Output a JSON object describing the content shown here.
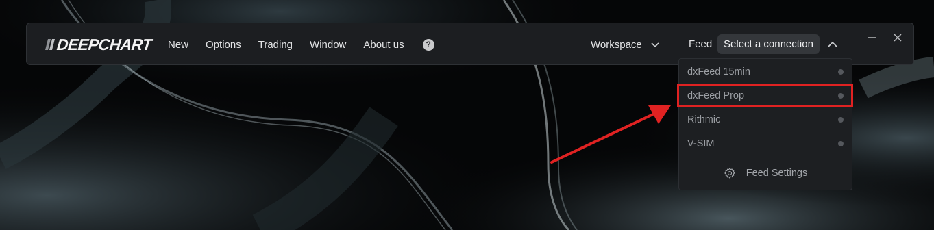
{
  "app": {
    "logo_text": "DEEPCHART"
  },
  "menu": {
    "items": [
      {
        "label": "New"
      },
      {
        "label": "Options"
      },
      {
        "label": "Trading"
      },
      {
        "label": "Window"
      },
      {
        "label": "About us"
      }
    ],
    "help_icon": "?"
  },
  "workspace": {
    "label": "Workspace"
  },
  "feed": {
    "label": "Feed",
    "connection_button": "Select a connection"
  },
  "dropdown": {
    "items": [
      {
        "label": "dxFeed 15min",
        "status": "inactive"
      },
      {
        "label": "dxFeed Prop",
        "status": "inactive",
        "highlighted": true
      },
      {
        "label": "Rithmic",
        "status": "inactive"
      },
      {
        "label": "V-SIM",
        "status": "inactive"
      }
    ],
    "settings_label": "Feed Settings"
  },
  "colors": {
    "titlebar_bg": "#1c1e21",
    "dropdown_bg": "#1d1f22",
    "annotation_red": "#e02222",
    "status_dot": "#55585d"
  },
  "icons": {
    "help": "question-circle-icon",
    "workspace_chevron": "chevron-down-icon",
    "connection_chevron": "chevron-up-icon",
    "minimize": "minimize-icon",
    "close": "close-icon",
    "settings": "gear-icon"
  }
}
